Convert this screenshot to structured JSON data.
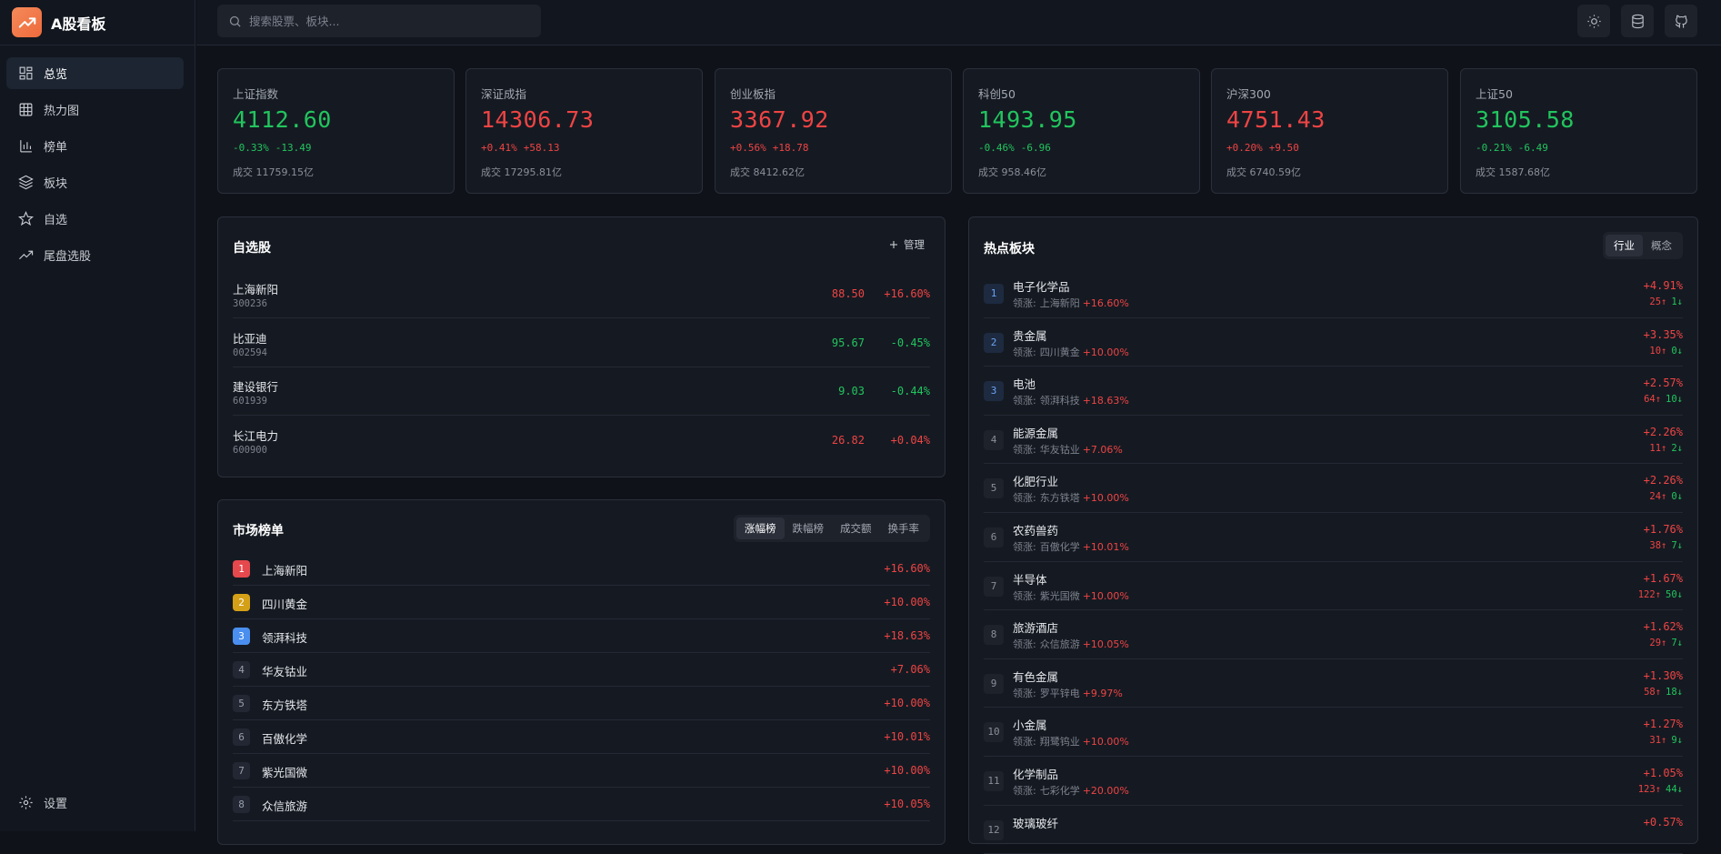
{
  "app": {
    "title": "A股看板"
  },
  "search": {
    "placeholder": "搜索股票、板块..."
  },
  "nav": {
    "items": [
      {
        "label": "总览",
        "icon": "dashboard-icon"
      },
      {
        "label": "热力图",
        "icon": "grid-icon"
      },
      {
        "label": "榜单",
        "icon": "bar-chart-icon"
      },
      {
        "label": "板块",
        "icon": "layers-icon"
      },
      {
        "label": "自选",
        "icon": "star-icon"
      },
      {
        "label": "尾盘选股",
        "icon": "trending-up-icon"
      }
    ],
    "settings": "设置"
  },
  "indices": [
    {
      "name": "上证指数",
      "value": "4112.60",
      "pct": "-0.33%",
      "chg": "-13.49",
      "volume": "成交 11759.15亿",
      "dir": "down"
    },
    {
      "name": "深证成指",
      "value": "14306.73",
      "pct": "+0.41%",
      "chg": "+58.13",
      "volume": "成交 17295.81亿",
      "dir": "up"
    },
    {
      "name": "创业板指",
      "value": "3367.92",
      "pct": "+0.56%",
      "chg": "+18.78",
      "volume": "成交 8412.62亿",
      "dir": "up"
    },
    {
      "name": "科创50",
      "value": "1493.95",
      "pct": "-0.46%",
      "chg": "-6.96",
      "volume": "成交 958.46亿",
      "dir": "down"
    },
    {
      "name": "沪深300",
      "value": "4751.43",
      "pct": "+0.20%",
      "chg": "+9.50",
      "volume": "成交 6740.59亿",
      "dir": "up"
    },
    {
      "name": "上证50",
      "value": "3105.58",
      "pct": "-0.21%",
      "chg": "-6.49",
      "volume": "成交 1587.68亿",
      "dir": "down"
    }
  ],
  "watchlist": {
    "title": "自选股",
    "manage_label": "管理",
    "rows": [
      {
        "name": "上海新阳",
        "code": "300236",
        "price": "88.50",
        "pct": "+16.60%",
        "dir": "up"
      },
      {
        "name": "比亚迪",
        "code": "002594",
        "price": "95.67",
        "pct": "-0.45%",
        "dir": "down"
      },
      {
        "name": "建设银行",
        "code": "601939",
        "price": "9.03",
        "pct": "-0.44%",
        "dir": "down"
      },
      {
        "name": "长江电力",
        "code": "600900",
        "price": "26.82",
        "pct": "+0.04%",
        "dir": "up"
      }
    ]
  },
  "ranking": {
    "title": "市场榜单",
    "tabs": [
      "涨幅榜",
      "跌幅榜",
      "成交额",
      "换手率"
    ],
    "rows": [
      {
        "rank": "1",
        "name": "上海新阳",
        "pct": "+16.60%",
        "badge": "#e5484d"
      },
      {
        "rank": "2",
        "name": "四川黄金",
        "pct": "+10.00%",
        "badge": "#d4a017"
      },
      {
        "rank": "3",
        "name": "领湃科技",
        "pct": "+18.63%",
        "badge": "#4a8ff0"
      },
      {
        "rank": "4",
        "name": "华友钴业",
        "pct": "+7.06%",
        "badge": ""
      },
      {
        "rank": "5",
        "name": "东方铁塔",
        "pct": "+10.00%",
        "badge": ""
      },
      {
        "rank": "6",
        "name": "百傲化学",
        "pct": "+10.01%",
        "badge": ""
      },
      {
        "rank": "7",
        "name": "紫光国微",
        "pct": "+10.00%",
        "badge": ""
      },
      {
        "rank": "8",
        "name": "众信旅游",
        "pct": "+10.05%",
        "badge": ""
      }
    ]
  },
  "sectors": {
    "title": "热点板块",
    "tabs": [
      "行业",
      "概念"
    ],
    "lead_prefix": "领涨:",
    "rows": [
      {
        "rank": "1",
        "name": "电子化学品",
        "lead": "上海新阳",
        "lead_pct": "+16.60%",
        "pct": "+4.91%",
        "ups": "25↑",
        "downs": "1↓"
      },
      {
        "rank": "2",
        "name": "贵金属",
        "lead": "四川黄金",
        "lead_pct": "+10.00%",
        "pct": "+3.35%",
        "ups": "10↑",
        "downs": "0↓"
      },
      {
        "rank": "3",
        "name": "电池",
        "lead": "领湃科技",
        "lead_pct": "+18.63%",
        "pct": "+2.57%",
        "ups": "64↑",
        "downs": "10↓"
      },
      {
        "rank": "4",
        "name": "能源金属",
        "lead": "华友钴业",
        "lead_pct": "+7.06%",
        "pct": "+2.26%",
        "ups": "11↑",
        "downs": "2↓"
      },
      {
        "rank": "5",
        "name": "化肥行业",
        "lead": "东方铁塔",
        "lead_pct": "+10.00%",
        "pct": "+2.26%",
        "ups": "24↑",
        "downs": "0↓"
      },
      {
        "rank": "6",
        "name": "农药兽药",
        "lead": "百傲化学",
        "lead_pct": "+10.01%",
        "pct": "+1.76%",
        "ups": "38↑",
        "downs": "7↓"
      },
      {
        "rank": "7",
        "name": "半导体",
        "lead": "紫光国微",
        "lead_pct": "+10.00%",
        "pct": "+1.67%",
        "ups": "122↑",
        "downs": "50↓"
      },
      {
        "rank": "8",
        "name": "旅游酒店",
        "lead": "众信旅游",
        "lead_pct": "+10.05%",
        "pct": "+1.62%",
        "ups": "29↑",
        "downs": "7↓"
      },
      {
        "rank": "9",
        "name": "有色金属",
        "lead": "罗平锌电",
        "lead_pct": "+9.97%",
        "pct": "+1.30%",
        "ups": "58↑",
        "downs": "18↓"
      },
      {
        "rank": "10",
        "name": "小金属",
        "lead": "翔鹭钨业",
        "lead_pct": "+10.00%",
        "pct": "+1.27%",
        "ups": "31↑",
        "downs": "9↓"
      },
      {
        "rank": "11",
        "name": "化学制品",
        "lead": "七彩化学",
        "lead_pct": "+20.00%",
        "pct": "+1.05%",
        "ups": "123↑",
        "downs": "44↓"
      },
      {
        "rank": "12",
        "name": "玻璃玻纤",
        "lead": "",
        "lead_pct": "",
        "pct": "+0.57%",
        "ups": "",
        "downs": ""
      }
    ]
  }
}
